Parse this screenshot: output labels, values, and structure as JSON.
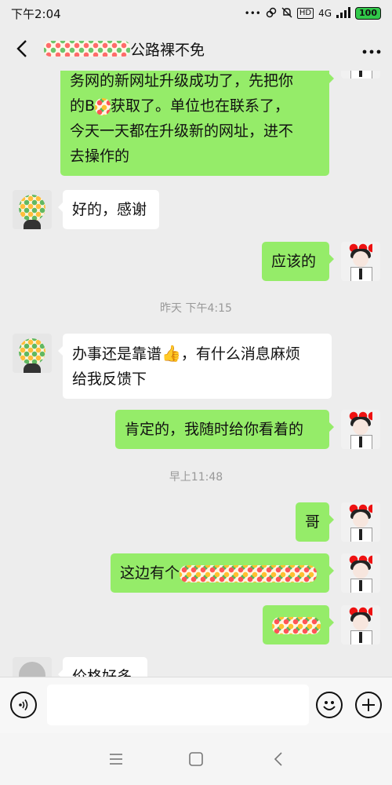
{
  "status_bar": {
    "time": "下午2:04",
    "dots": "•••",
    "hd": "HD",
    "network": "4G",
    "battery": "100"
  },
  "header": {
    "title": "公路裸不免"
  },
  "messages": [
    {
      "side": "me",
      "lines": [
        "务网的新网址升级成功了，先把你",
        "的B",
        "获取了。单位也在联系了，",
        "今天一天都在升级新的网址，进不",
        "去操作的"
      ]
    },
    {
      "side": "other",
      "text": "好的，感谢"
    },
    {
      "side": "me",
      "text": "应该的"
    },
    {
      "type": "time",
      "text": "昨天 下午4:15"
    },
    {
      "side": "other",
      "line1_a": "办事还是靠谱",
      "line1_b": "，有什么消息麻烦",
      "line2": "给我反馈下"
    },
    {
      "side": "me",
      "text": "肯定的，我随时给你看着的"
    },
    {
      "type": "time",
      "text": "早上11:48"
    },
    {
      "side": "me",
      "text": "哥"
    },
    {
      "side": "me",
      "text": "这边有个"
    },
    {
      "side": "me",
      "text": ""
    },
    {
      "side": "other",
      "text": "价格好多"
    }
  ],
  "thumb_emoji": "👍",
  "colors": {
    "me_bubble": "#95ec69",
    "other_bubble": "#ffffff",
    "background": "#ededed"
  }
}
